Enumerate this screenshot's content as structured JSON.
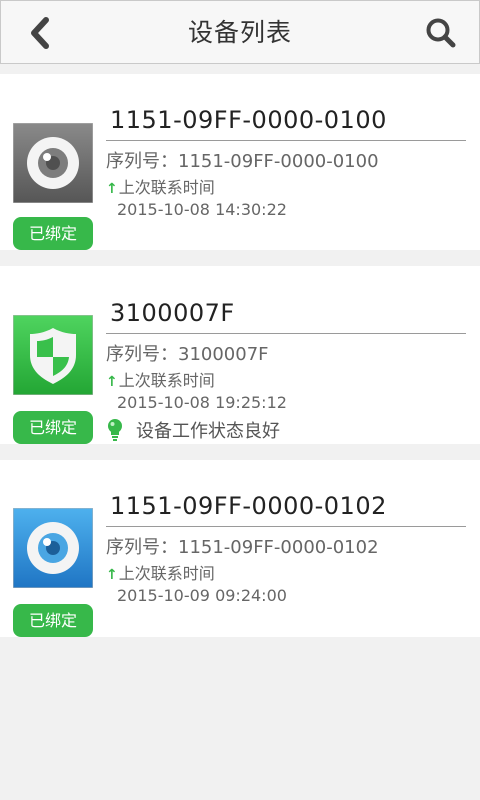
{
  "header": {
    "title": "设备列表",
    "back_icon": "chevron-left-icon",
    "search_icon": "search-icon"
  },
  "devices": [
    {
      "name": "1151-09FF-0000-0100",
      "serial": "序列号：1151-09FF-0000-0100",
      "contact_label": "上次联系时间",
      "contact_time": "2015-10-08 14:30:22",
      "badge": "已绑定",
      "icon": "gray-camera-eye-icon",
      "status": ""
    },
    {
      "name": "3100007F",
      "serial": "序列号：3100007F",
      "contact_label": "上次联系时间",
      "contact_time": "2015-10-08 19:25:12",
      "badge": "已绑定",
      "icon": "green-shield-icon",
      "status": "设备工作状态良好"
    },
    {
      "name": "1151-09FF-0000-0102",
      "serial": "序列号：1151-09FF-0000-0102",
      "contact_label": "上次联系时间",
      "contact_time": "2015-10-09 09:24:00",
      "badge": "已绑定",
      "icon": "blue-camera-eye-icon",
      "status": ""
    }
  ],
  "colors": {
    "accent_green": "#37b84a",
    "background": "#f1f1f1",
    "card": "#ffffff",
    "gray_icon": "#6f6f6f",
    "blue_icon": "#2f8fd8"
  }
}
